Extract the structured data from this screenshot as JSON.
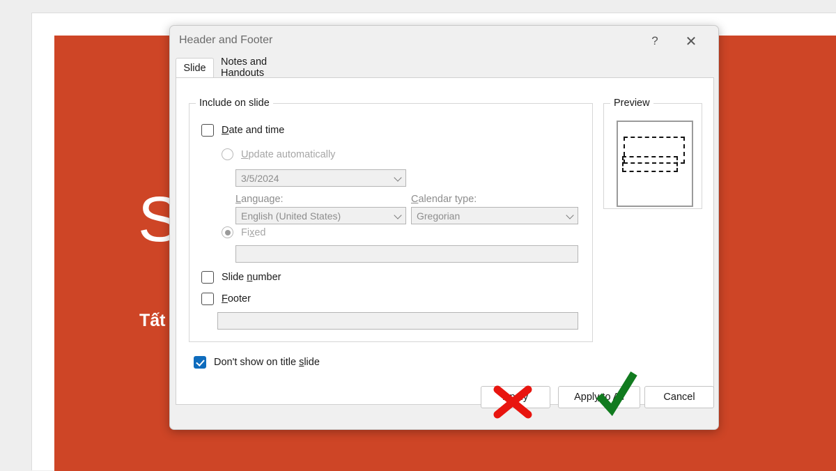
{
  "background": {
    "slide_title": "Sfo",
    "slide_subtitle": "Tất tầ",
    "slide_color": "#ce4526"
  },
  "dialog": {
    "title": "Header and Footer",
    "help_icon": "question-mark-icon",
    "close_icon": "close-icon",
    "tabs": [
      {
        "label": "Slide",
        "active": true
      },
      {
        "label": "Notes and Handouts",
        "active": false
      }
    ],
    "include_group": {
      "legend": "Include on slide",
      "date_and_time": {
        "label": "Date and time",
        "checked": false
      },
      "update_automatically": {
        "label": "Update automatically",
        "selected": false,
        "disabled": true,
        "date_value": "3/5/2024"
      },
      "language": {
        "label": "Language:",
        "value": "English (United States)"
      },
      "calendar_type": {
        "label": "Calendar type:",
        "value": "Gregorian"
      },
      "fixed": {
        "label": "Fixed",
        "selected": true,
        "disabled": true,
        "value": "",
        "placeholder": ""
      },
      "slide_number": {
        "label": "Slide number",
        "checked": false
      },
      "footer": {
        "label": "Footer",
        "checked": false,
        "value": "",
        "placeholder": ""
      }
    },
    "preview": {
      "legend": "Preview"
    },
    "dont_show_on_title_slide": {
      "label": "Don't show on title slide",
      "checked": true
    },
    "buttons": {
      "apply": "Apply",
      "apply_to_all": "Apply to All",
      "cancel": "Cancel"
    },
    "annotations": {
      "apply_mark": "red-x-icon",
      "apply_to_all_mark": "green-check-icon",
      "apply_mark_color": "#e8150f",
      "apply_to_all_mark_color": "#117b1f"
    }
  }
}
